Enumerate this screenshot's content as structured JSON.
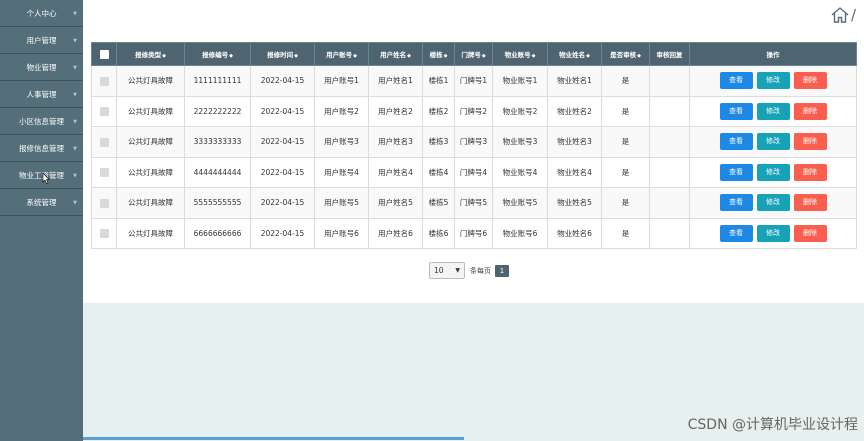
{
  "sidebar": {
    "items": [
      {
        "label": "个人中心"
      },
      {
        "label": "用户管理"
      },
      {
        "label": "物业管理"
      },
      {
        "label": "人事管理"
      },
      {
        "label": "小区信息管理"
      },
      {
        "label": "报修信息管理"
      },
      {
        "label": "物业工资管理"
      },
      {
        "label": "系统管理"
      }
    ]
  },
  "breadcrumb": {
    "separator": "/"
  },
  "table": {
    "columns": [
      "报修类型",
      "报修编号",
      "报修时间",
      "用户账号",
      "用户姓名",
      "楼栋",
      "门牌号",
      "物业账号",
      "物业姓名",
      "是否审核",
      "审核回复",
      "操作"
    ],
    "rows": [
      [
        "公共灯具故障",
        "1111111111",
        "2022-04-15",
        "用户账号1",
        "用户姓名1",
        "楼栋1",
        "门牌号1",
        "物业账号1",
        "物业姓名1",
        "是",
        ""
      ],
      [
        "公共灯具故障",
        "2222222222",
        "2022-04-15",
        "用户账号2",
        "用户姓名2",
        "楼栋2",
        "门牌号2",
        "物业账号2",
        "物业姓名2",
        "是",
        ""
      ],
      [
        "公共灯具故障",
        "3333333333",
        "2022-04-15",
        "用户账号3",
        "用户姓名3",
        "楼栋3",
        "门牌号3",
        "物业账号3",
        "物业姓名3",
        "是",
        ""
      ],
      [
        "公共灯具故障",
        "4444444444",
        "2022-04-15",
        "用户账号4",
        "用户姓名4",
        "楼栋4",
        "门牌号4",
        "物业账号4",
        "物业姓名4",
        "是",
        ""
      ],
      [
        "公共灯具故障",
        "5555555555",
        "2022-04-15",
        "用户账号5",
        "用户姓名5",
        "楼栋5",
        "门牌号5",
        "物业账号5",
        "物业姓名5",
        "是",
        ""
      ],
      [
        "公共灯具故障",
        "6666666666",
        "2022-04-15",
        "用户账号6",
        "用户姓名6",
        "楼栋6",
        "门牌号6",
        "物业账号6",
        "物业姓名6",
        "是",
        ""
      ]
    ],
    "actions": {
      "view": "查看",
      "edit": "修改",
      "delete": "删除"
    }
  },
  "pagination": {
    "page_size": "10",
    "per_page_label": "条每页",
    "current_page": "1"
  },
  "watermark": "CSDN @计算机毕业设计程",
  "colors": {
    "sidebar": "#546e7a",
    "header": "#4e6470",
    "view": "#1e88e5",
    "edit": "#17a2b8",
    "delete": "#f95e4e"
  }
}
